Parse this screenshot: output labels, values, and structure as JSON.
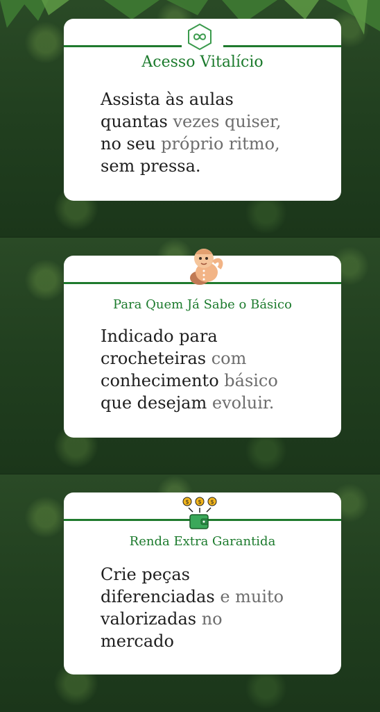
{
  "cards": [
    {
      "icon": "infinity-hexagon-icon",
      "title": "Acesso Vitalício",
      "body": [
        {
          "text": "Assista às aulas",
          "muted": false
        },
        {
          "text": "quantas ",
          "muted": false,
          "rest": "vezes quiser,"
        },
        {
          "text": "no seu ",
          "muted": false,
          "rest": "próprio ritmo,"
        },
        {
          "text": "sem pressa.",
          "muted": false
        }
      ]
    },
    {
      "icon": "baby-doll-icon",
      "title": "Para Quem Já Sabe o Básico",
      "body": [
        {
          "text": "Indicado para",
          "muted": false
        },
        {
          "text": "crocheteiras ",
          "muted": false,
          "rest": "com"
        },
        {
          "text": "conhecimento ",
          "muted": false,
          "rest": "básico"
        },
        {
          "text": "que desejam ",
          "muted": false,
          "rest": "evoluir."
        }
      ]
    },
    {
      "icon": "wallet-coins-icon",
      "title": "Renda Extra Garantida",
      "body": [
        {
          "text": "Crie peças",
          "muted": false
        },
        {
          "text": "diferenciadas ",
          "muted": false,
          "rest": "e muito"
        },
        {
          "text": "valorizadas ",
          "muted": false,
          "rest": "no"
        },
        {
          "text": "mercado",
          "muted": false
        }
      ]
    }
  ],
  "colors": {
    "accent_green": "#1f7a2e",
    "title_green": "#1b7a2c",
    "card_bg": "#ffffff",
    "forest": "#213f1f"
  }
}
